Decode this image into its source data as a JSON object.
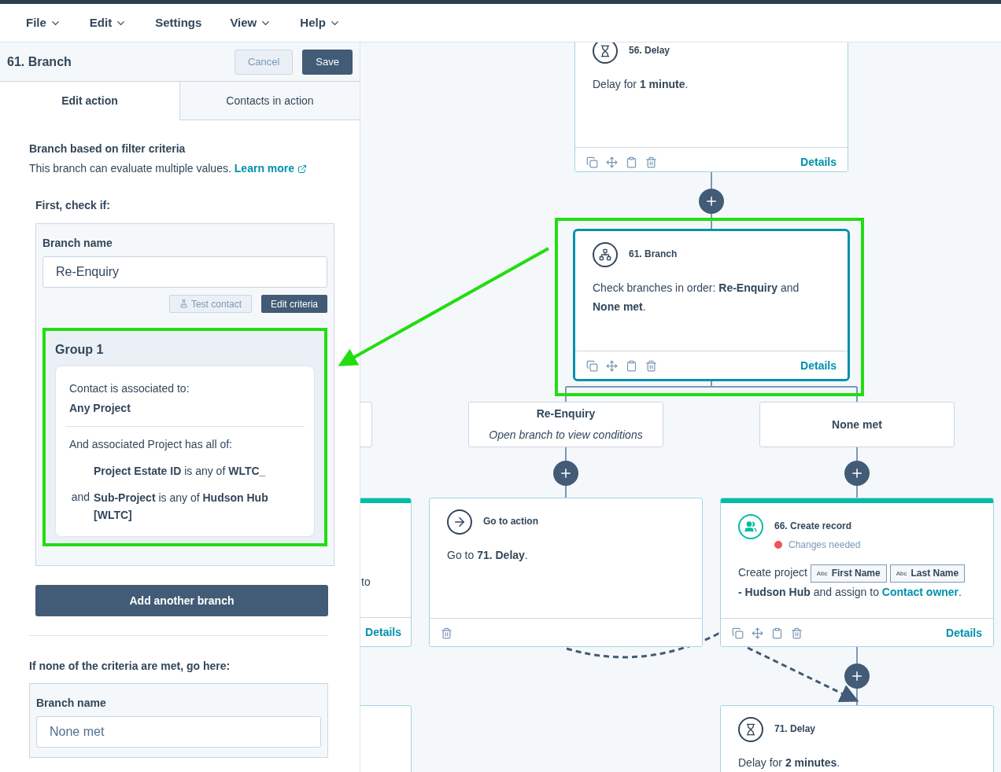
{
  "menu": [
    {
      "label": "File",
      "dropdown": true
    },
    {
      "label": "Edit",
      "dropdown": true
    },
    {
      "label": "Settings",
      "dropdown": false
    },
    {
      "label": "View",
      "dropdown": true
    },
    {
      "label": "Help",
      "dropdown": true
    }
  ],
  "panel": {
    "title": "61. Branch",
    "cancel": "Cancel",
    "save": "Save",
    "tabs": [
      {
        "label": "Edit action",
        "selected": true
      },
      {
        "label": "Contacts in action",
        "selected": false
      }
    ],
    "heading": "Branch based on filter criteria",
    "description": "This branch can evaluate multiple values.",
    "learn_more": "Learn more",
    "first_check": "First, check if:",
    "branch": {
      "name_label": "Branch name",
      "name_value": "Re-Enquiry",
      "test_contact": "Test contact",
      "edit_criteria": "Edit criteria",
      "group": {
        "title": "Group 1",
        "highlighted": true,
        "association": "Contact is associated to:",
        "association_value": "Any Project",
        "conditions_intro": "And associated Project has all of:",
        "conditions": [
          {
            "text": "**Project Estate ID** is any of **WLTC_**"
          },
          {
            "prefix": "and",
            "text": "**Sub-Project** is any of **Hudson Hub [WLTC]**"
          }
        ]
      }
    },
    "add_branch": "Add another branch",
    "none_heading": "If none of the criteria are met, go here:",
    "none_branch": {
      "name_label": "Branch name",
      "name_value": "None met"
    }
  },
  "canvas": {
    "top_delay": {
      "kind": "delay",
      "title": "56. Delay",
      "body": "Delay for **1 minute**.",
      "details": "Details",
      "selected": false,
      "accent": false
    },
    "branch_node": {
      "kind": "branch",
      "title": "61. Branch",
      "body": "Check branches in order: **Re-Enquiry** and **None met**.",
      "details": "Details",
      "selected": true,
      "accent": false,
      "highlighted": true
    },
    "branches": [
      {
        "title": "Re-Enquiry",
        "subtitle": "Open branch to view conditions"
      },
      {
        "title": "None met"
      }
    ],
    "partial_card": {
      "text": "to",
      "details": "Details",
      "accent": true
    },
    "goto_node": {
      "kind": "goto",
      "title": "Go to action",
      "body": "Go to **71. Delay**.",
      "selected": false,
      "accent": false
    },
    "create_node": {
      "kind": "create_record",
      "title": "66. Create record",
      "status": {
        "text": "Changes needed",
        "color": "#f2545b"
      },
      "details": "Details",
      "selected": false,
      "accent": true,
      "body_parts": [
        {
          "kind": "text",
          "text": "Create project"
        },
        {
          "kind": "token",
          "prefix": "Abc",
          "text": "First Name"
        },
        {
          "kind": "token",
          "prefix": "Abc",
          "text": "Last Name"
        },
        {
          "kind": "text",
          "text": "**- Hudson Hub** and assign to"
        },
        {
          "kind": "link",
          "text": "Contact owner"
        },
        {
          "kind": "text",
          "text": "."
        }
      ]
    },
    "bottom_delay": {
      "kind": "delay",
      "title": "71. Delay",
      "body": "Delay for **2 minutes**.",
      "selected": false,
      "accent": false
    }
  },
  "annotation_arrow": true
}
